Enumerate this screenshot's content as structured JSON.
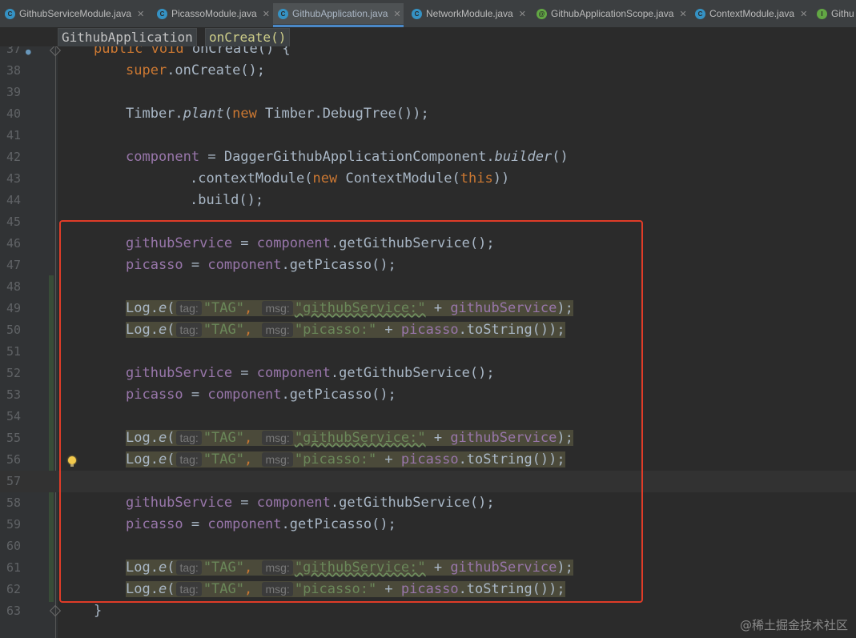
{
  "tabs": [
    {
      "label": "GithubServiceModule.java",
      "icon": "class-icon",
      "active": false,
      "closable": true
    },
    {
      "label": "PicassoModule.java",
      "icon": "class-icon",
      "active": false,
      "closable": true
    },
    {
      "label": "GithubApplication.java",
      "icon": "class-icon",
      "active": true,
      "closable": true
    },
    {
      "label": "NetworkModule.java",
      "icon": "class-icon",
      "active": false,
      "closable": true
    },
    {
      "label": "GithubApplicationScope.java",
      "icon": "annotation-icon",
      "active": false,
      "closable": true
    },
    {
      "label": "ContextModule.java",
      "icon": "class-icon",
      "active": false,
      "closable": true
    },
    {
      "label": "Githu",
      "icon": "interface-icon",
      "active": false,
      "closable": false
    }
  ],
  "breadcrumb": {
    "class_name": "GithubApplication",
    "method_name": "onCreate()"
  },
  "colors": {
    "keyword": "#cc7832",
    "field": "#9876aa",
    "string": "#6a8759",
    "default_text": "#a9b7c6",
    "line_number": "#606366",
    "selection_box": "#e03c28",
    "hint_text": "#787878"
  },
  "code_lines": [
    {
      "number": "37",
      "tokens": [
        {
          "t": "public void ",
          "c": "kw"
        },
        {
          "t": "onCreate",
          "c": ""
        },
        {
          "t": "() {",
          "c": ""
        }
      ]
    },
    {
      "number": "38",
      "tokens": [
        {
          "t": "super",
          "c": "kw"
        },
        {
          "t": ".onCreate();",
          "c": ""
        }
      ]
    },
    {
      "number": "39",
      "tokens": []
    },
    {
      "number": "40",
      "tokens": [
        {
          "t": "Timber.",
          "c": ""
        },
        {
          "t": "plant",
          "c": "it"
        },
        {
          "t": "(",
          "c": ""
        },
        {
          "t": "new ",
          "c": "kw"
        },
        {
          "t": "Timber.DebugTree());",
          "c": ""
        }
      ]
    },
    {
      "number": "41",
      "tokens": []
    },
    {
      "number": "42",
      "tokens": [
        {
          "t": "component",
          "c": "fld"
        },
        {
          "t": " = DaggerGithubApplicationComponent.",
          "c": ""
        },
        {
          "t": "builder",
          "c": "it"
        },
        {
          "t": "()",
          "c": ""
        }
      ]
    },
    {
      "number": "43",
      "tokens": [
        {
          "t": ".contextModule(",
          "c": ""
        },
        {
          "t": "new ",
          "c": "kw"
        },
        {
          "t": "ContextModule(",
          "c": ""
        },
        {
          "t": "this",
          "c": "kw"
        },
        {
          "t": "))",
          "c": ""
        }
      ]
    },
    {
      "number": "44",
      "tokens": [
        {
          "t": ".build();",
          "c": ""
        }
      ]
    },
    {
      "number": "45",
      "tokens": []
    },
    {
      "number": "46",
      "tokens": [
        {
          "t": "githubService",
          "c": "fld"
        },
        {
          "t": " = ",
          "c": ""
        },
        {
          "t": "component",
          "c": "fld"
        },
        {
          "t": ".getGithubService();",
          "c": ""
        }
      ]
    },
    {
      "number": "47",
      "tokens": [
        {
          "t": "picasso",
          "c": "fld"
        },
        {
          "t": " = ",
          "c": ""
        },
        {
          "t": "component",
          "c": "fld"
        },
        {
          "t": ".getPicasso();",
          "c": ""
        }
      ]
    },
    {
      "number": "48",
      "tokens": []
    },
    {
      "number": "49",
      "tokens": [
        {
          "t": "Log.",
          "c": ""
        },
        {
          "t": "e",
          "c": "it"
        },
        {
          "t": "(",
          "c": ""
        },
        {
          "t": "tag:",
          "c": "hint"
        },
        {
          "t": "\"TAG\"",
          "c": "str"
        },
        {
          "t": ", ",
          "c": "kw"
        },
        {
          "t": "msg:",
          "c": "hint"
        },
        {
          "t": "\"githubService:\"",
          "c": "str squig"
        },
        {
          "t": " + ",
          "c": ""
        },
        {
          "t": "githubService",
          "c": "fld"
        },
        {
          "t": ");",
          "c": ""
        }
      ]
    },
    {
      "number": "50",
      "tokens": [
        {
          "t": "Log.",
          "c": ""
        },
        {
          "t": "e",
          "c": "it"
        },
        {
          "t": "(",
          "c": ""
        },
        {
          "t": "tag:",
          "c": "hint"
        },
        {
          "t": "\"TAG\"",
          "c": "str"
        },
        {
          "t": ", ",
          "c": "kw"
        },
        {
          "t": "msg:",
          "c": "hint"
        },
        {
          "t": "\"picasso:\"",
          "c": "str"
        },
        {
          "t": " + ",
          "c": ""
        },
        {
          "t": "picasso",
          "c": "fld"
        },
        {
          "t": ".toString());",
          "c": ""
        }
      ]
    },
    {
      "number": "51",
      "tokens": []
    },
    {
      "number": "52",
      "tokens": [
        {
          "t": "githubService",
          "c": "fld"
        },
        {
          "t": " = ",
          "c": ""
        },
        {
          "t": "component",
          "c": "fld"
        },
        {
          "t": ".getGithubService();",
          "c": ""
        }
      ]
    },
    {
      "number": "53",
      "tokens": [
        {
          "t": "picasso",
          "c": "fld"
        },
        {
          "t": " = ",
          "c": ""
        },
        {
          "t": "component",
          "c": "fld"
        },
        {
          "t": ".getPicasso();",
          "c": ""
        }
      ]
    },
    {
      "number": "54",
      "tokens": []
    },
    {
      "number": "55",
      "tokens": [
        {
          "t": "Log.",
          "c": ""
        },
        {
          "t": "e",
          "c": "it"
        },
        {
          "t": "(",
          "c": ""
        },
        {
          "t": "tag:",
          "c": "hint"
        },
        {
          "t": "\"TAG\"",
          "c": "str"
        },
        {
          "t": ", ",
          "c": "kw"
        },
        {
          "t": "msg:",
          "c": "hint"
        },
        {
          "t": "\"githubService:\"",
          "c": "str squig"
        },
        {
          "t": " + ",
          "c": ""
        },
        {
          "t": "githubService",
          "c": "fld"
        },
        {
          "t": ");",
          "c": ""
        }
      ]
    },
    {
      "number": "56",
      "tokens": [
        {
          "t": "Log.",
          "c": ""
        },
        {
          "t": "e",
          "c": "it"
        },
        {
          "t": "(",
          "c": ""
        },
        {
          "t": "tag:",
          "c": "hint"
        },
        {
          "t": "\"TAG\"",
          "c": "str"
        },
        {
          "t": ", ",
          "c": "kw"
        },
        {
          "t": "msg:",
          "c": "hint"
        },
        {
          "t": "\"picasso:\"",
          "c": "str"
        },
        {
          "t": " + ",
          "c": ""
        },
        {
          "t": "picasso",
          "c": "fld"
        },
        {
          "t": ".toString());",
          "c": ""
        }
      ]
    },
    {
      "number": "57",
      "tokens": []
    },
    {
      "number": "58",
      "tokens": [
        {
          "t": "githubService",
          "c": "fld"
        },
        {
          "t": " = ",
          "c": ""
        },
        {
          "t": "component",
          "c": "fld"
        },
        {
          "t": ".getGithubService();",
          "c": ""
        }
      ]
    },
    {
      "number": "59",
      "tokens": [
        {
          "t": "picasso",
          "c": "fld"
        },
        {
          "t": " = ",
          "c": ""
        },
        {
          "t": "component",
          "c": "fld"
        },
        {
          "t": ".getPicasso();",
          "c": ""
        }
      ]
    },
    {
      "number": "60",
      "tokens": []
    },
    {
      "number": "61",
      "tokens": [
        {
          "t": "Log.",
          "c": ""
        },
        {
          "t": "e",
          "c": "it"
        },
        {
          "t": "(",
          "c": ""
        },
        {
          "t": "tag:",
          "c": "hint"
        },
        {
          "t": "\"TAG\"",
          "c": "str"
        },
        {
          "t": ", ",
          "c": "kw"
        },
        {
          "t": "msg:",
          "c": "hint"
        },
        {
          "t": "\"githubService:\"",
          "c": "str squig"
        },
        {
          "t": " + ",
          "c": ""
        },
        {
          "t": "githubService",
          "c": "fld"
        },
        {
          "t": ");",
          "c": ""
        }
      ]
    },
    {
      "number": "62",
      "tokens": [
        {
          "t": "Log.",
          "c": ""
        },
        {
          "t": "e",
          "c": "it"
        },
        {
          "t": "(",
          "c": ""
        },
        {
          "t": "tag:",
          "c": "hint"
        },
        {
          "t": "\"TAG\"",
          "c": "str"
        },
        {
          "t": ", ",
          "c": "kw"
        },
        {
          "t": "msg:",
          "c": "hint"
        },
        {
          "t": "\"picasso:\"",
          "c": "str"
        },
        {
          "t": " + ",
          "c": ""
        },
        {
          "t": "picasso",
          "c": "fld"
        },
        {
          "t": ".toString());",
          "c": ""
        }
      ]
    },
    {
      "number": "63",
      "tokens": [
        {
          "t": "}",
          "c": ""
        }
      ]
    }
  ],
  "watermark": "@稀土掘金技术社区"
}
